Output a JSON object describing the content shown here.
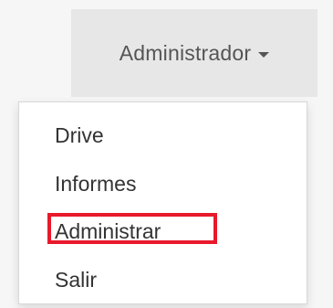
{
  "navbar": {
    "toggle_label": "Administrador"
  },
  "dropdown": {
    "items": [
      {
        "label": "Drive"
      },
      {
        "label": "Informes"
      },
      {
        "label": "Administrar"
      },
      {
        "label": "Salir"
      }
    ]
  },
  "highlight": {
    "color": "#e8192c"
  }
}
